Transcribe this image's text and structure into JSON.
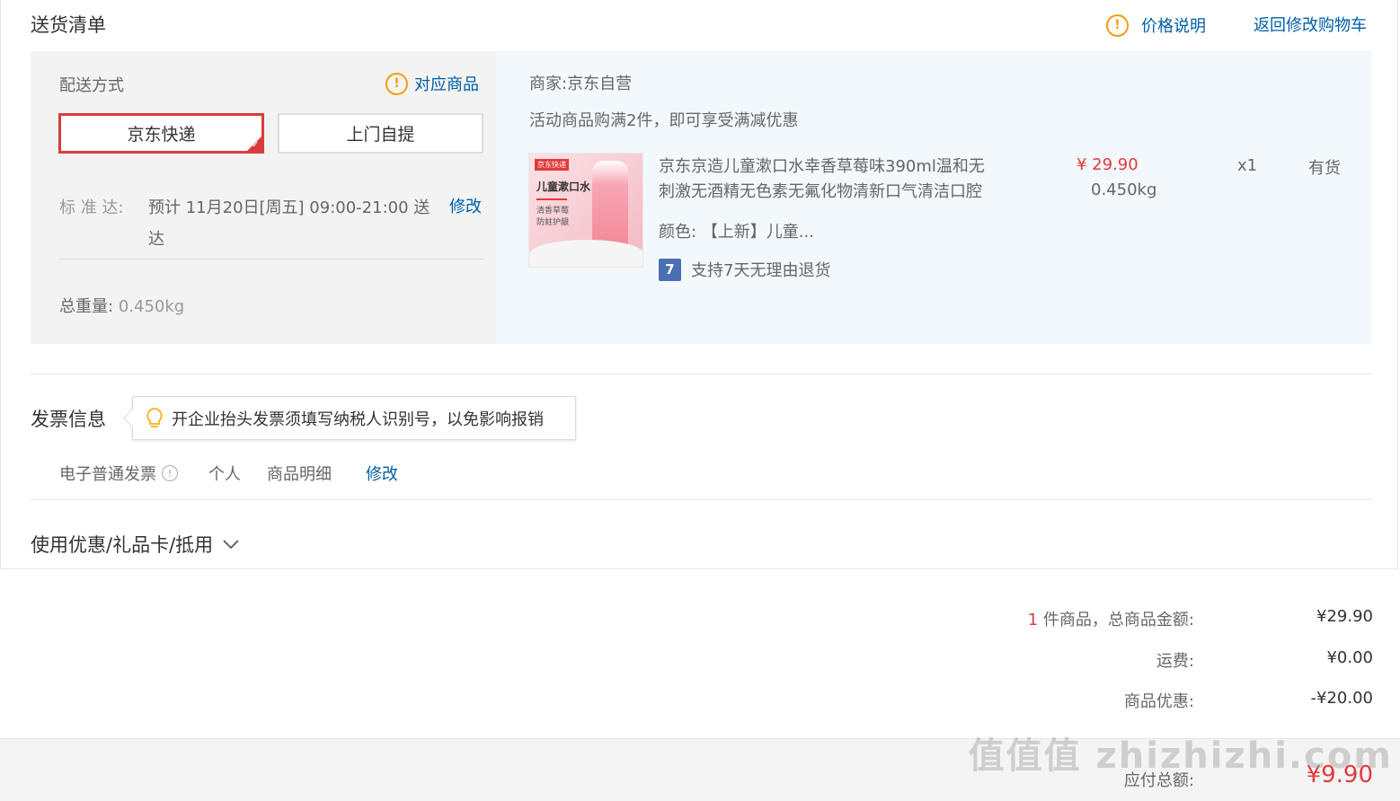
{
  "delivery_list": {
    "title": "送货清单",
    "price_note": "价格说明",
    "back_to_cart": "返回修改购物车"
  },
  "shipping": {
    "label": "配送方式",
    "match_goods": "对应商品",
    "options": [
      "京东快递",
      "上门自提"
    ],
    "selected": "京东快递",
    "standard_label": "标 准 达:",
    "eta_line1": "预计 11月20日[周五] 09:00-21:00 送",
    "eta_line2": "达",
    "modify": "修改",
    "weight_label": "总重量:",
    "weight_value": "0.450kg"
  },
  "merchant": {
    "label": "商家:",
    "name": "京东自营",
    "promo": "活动商品购满2件，即可享受满减优惠"
  },
  "product": {
    "image_logo": "京东快递",
    "image_title": "儿童漱口水",
    "image_sub1": "清香草莓",
    "image_sub2": "防蛀护龈",
    "title_line1": "京东京造儿童漱口水幸香草莓味390ml温和无",
    "title_line2": "刺激无酒精无色素无氟化物清新口气清洁口腔",
    "color_label": "颜色:",
    "color_value": "【上新】儿童...",
    "return_badge": "7",
    "return_policy": "支持7天无理由退货",
    "price": "¥ 29.90",
    "weight": "0.450kg",
    "quantity": "x1",
    "stock": "有货"
  },
  "invoice": {
    "title": "发票信息",
    "tip": "开企业抬头发票须填写纳税人识别号，以免影响报销",
    "type": "电子普通发票",
    "holder": "个人",
    "content": "商品明细",
    "modify": "修改"
  },
  "coupon": {
    "title": "使用优惠/礼品卡/抵用"
  },
  "summary": {
    "count": "1",
    "count_suffix": "件商品，总商品金额:",
    "goods_total": "¥29.90",
    "freight_label": "运费:",
    "freight": "¥0.00",
    "discount_label": "商品优惠:",
    "discount": "-¥20.00",
    "payable_label": "应付总额:",
    "payable": "¥9.90"
  },
  "watermark": "值值值 zhizhizhi.com",
  "colors": {
    "accent_red": "#e4393c",
    "link_blue": "#005ea7",
    "warn_orange": "#f39c12"
  }
}
